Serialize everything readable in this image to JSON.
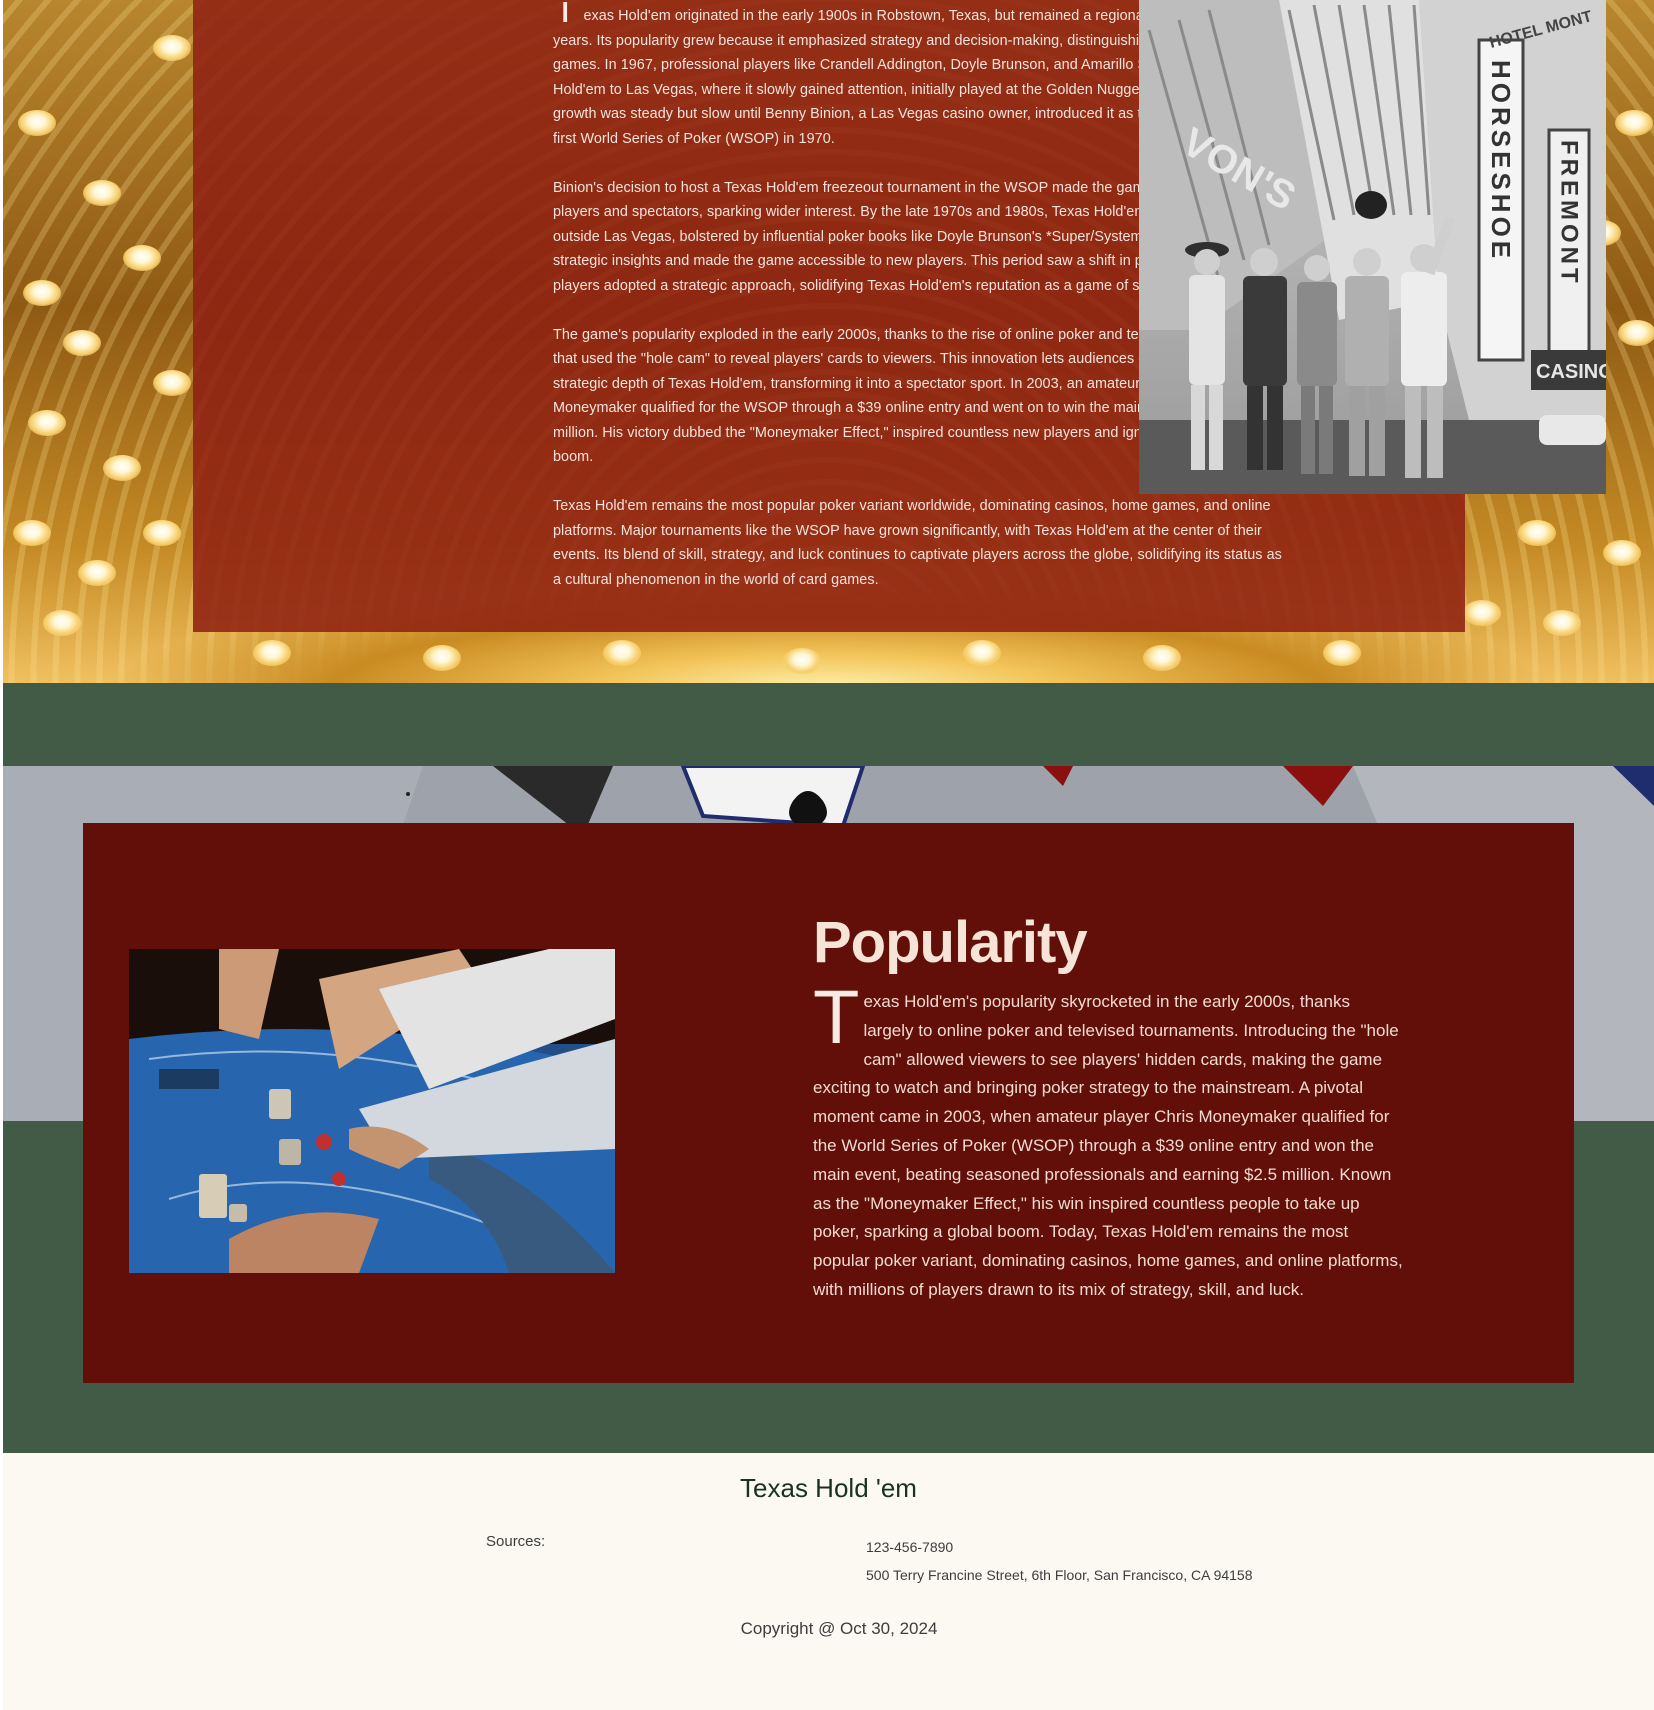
{
  "history": {
    "dropcap": "T",
    "paragraphs": [
      "exas Hold'em originated in the early 1900s in Robstown, Texas, but remained a regional game for many years. Its popularity grew because it emphasized strategy and decision-making, distinguishing it from other poker games. In 1967, professional players like Crandell Addington, Doyle Brunson, and Amarillo Slim brought Texas Hold'em to Las Vegas, where it slowly gained attention, initially played at the Golden Nugget Casino downtown. Its growth was steady but slow until Benny Binion, a Las Vegas casino owner, introduced it as the main event of the first World Series of Poker (WSOP) in 1970.",
      "Binion's decision to host a Texas Hold'em freezeout tournament in the WSOP made the game exciting for both players and spectators, sparking wider interest. By the late 1970s and 1980s, Texas Hold'em gained traction outside Las Vegas, bolstered by influential poker books like Doyle Brunson's *Super/System*, which shared strategic insights and made the game accessible to new players. This period saw a shift in poker culture as more players adopted a strategic approach, solidifying Texas Hold'em's reputation as a game of skill rather than luck.",
      "The game's popularity exploded in the early 2000s, thanks to the rise of online poker and televised tournaments that used the \"hole cam\" to reveal players' cards to viewers. This innovation lets audiences experience the strategic depth of Texas Hold'em, transforming it into a spectator sport. In 2003, an amateur named Chris Moneymaker qualified for the WSOP through a $39 online entry and went on to win the main event, earning $2.5 million. His victory dubbed the \"Moneymaker Effect,\" inspired countless new players and ignited a global poker boom.",
      "Texas Hold'em remains the most popular poker variant worldwide, dominating casinos, home games, and online platforms. Major tournaments like the WSOP have grown significantly, with Texas Hold'em at the center of their events. Its blend of skill, strategy, and luck continues to captivate players across the globe, solidifying its status as a cultural phenomenon in the world of card games."
    ],
    "photo_signs": {
      "sign_horseshoe": "HORSESHOE",
      "sign_fremont": "FREMONT",
      "sign_casino": "CASINO",
      "sign_vons": "VON'S",
      "sign_top": "HOTEL MONT"
    }
  },
  "popularity": {
    "title": "Popularity",
    "dropcap": "T",
    "body": "exas Hold'em's popularity skyrocketed in the early 2000s, thanks largely to online poker and televised tournaments. Introducing the \"hole cam\" allowed viewers to see players' hidden cards, making the game exciting to watch and bringing poker strategy to the mainstream. A pivotal moment came in 2003, when amateur player Chris Moneymaker qualified for the World Series of Poker (WSOP) through a $39 online entry and won the main event, beating seasoned professionals and earning $2.5 million. Known as the \"Moneymaker Effect,\" his win inspired countless people to take up poker, sparking a global boom. Today, Texas Hold'em remains the most popular poker variant, dominating casinos, home games, and online platforms, with millions of players drawn to its mix of strategy, skill, and luck."
  },
  "footer": {
    "title": "Texas Hold 'em",
    "sources_label": "Sources:",
    "phone": "123-456-7890",
    "address": "500 Terry Francine Street, 6th Floor, San Francisco, CA 94158",
    "copyright": "Copyright @ Oct 30, 2024"
  },
  "colors": {
    "history_panel": "#8e2012",
    "popularity_card": "#620f0a",
    "green_band": "#415b47",
    "footer_bg": "#fbf9f2",
    "footer_title": "#1b3120"
  }
}
